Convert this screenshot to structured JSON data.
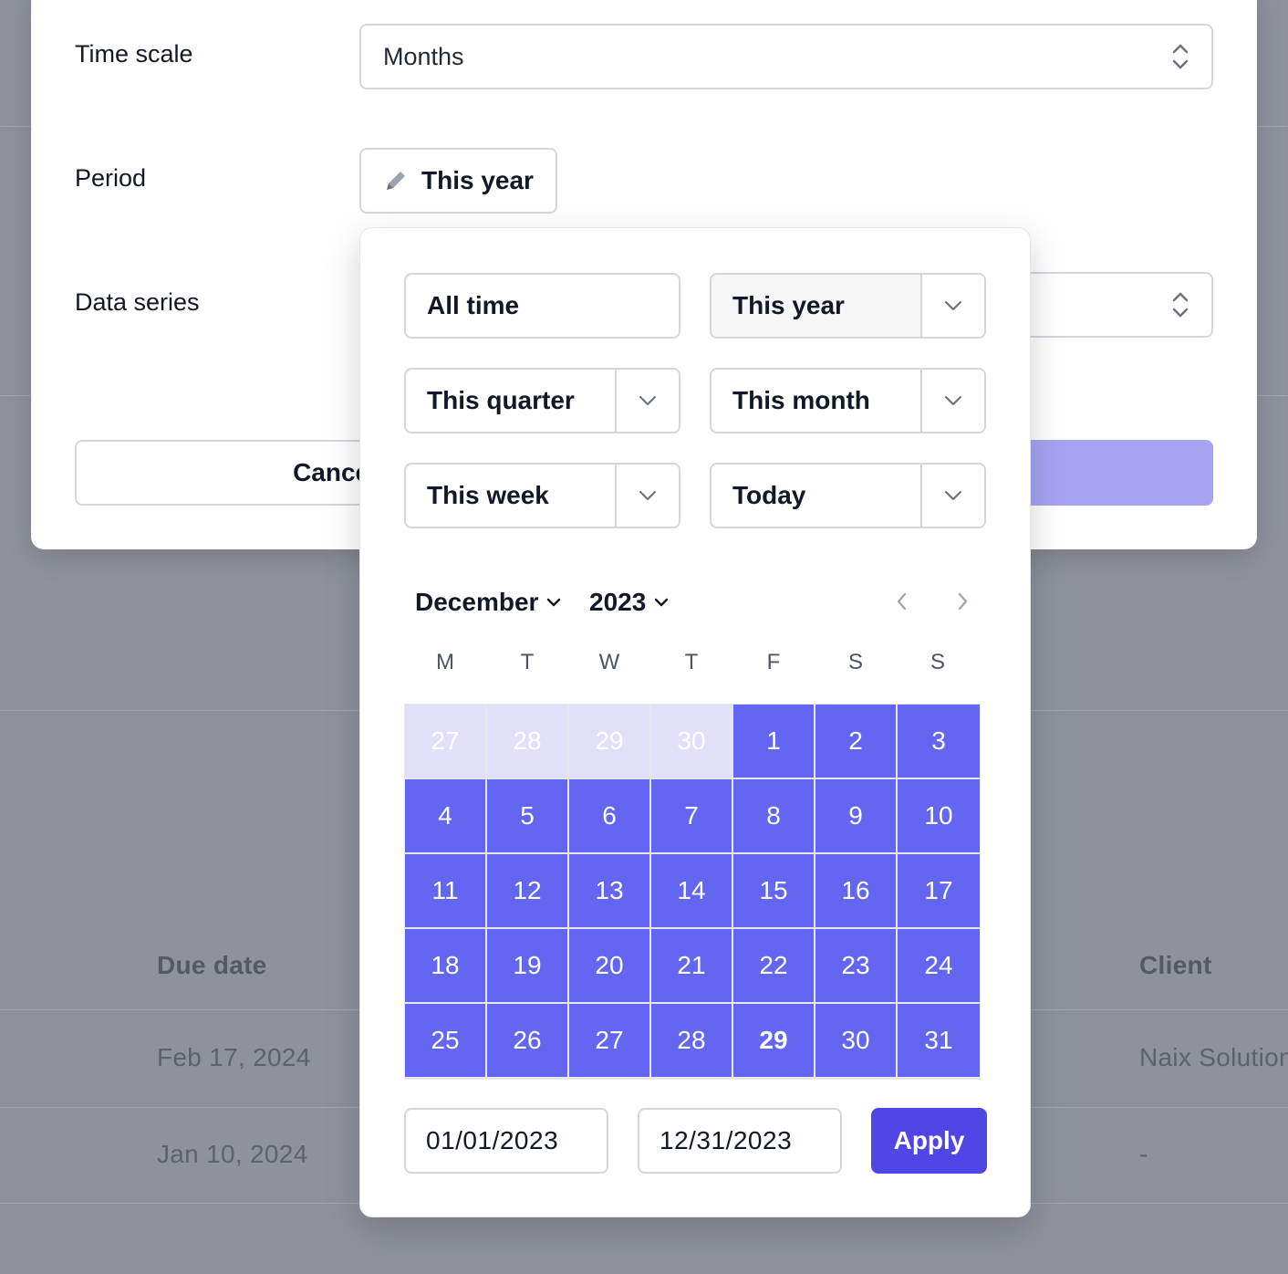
{
  "background": {
    "headers": {
      "due_date": "Due date",
      "client": "Client"
    },
    "rows": [
      {
        "due_date": "Feb 17, 2024",
        "client": "Naix Solution"
      },
      {
        "due_date": "Jan 10, 2024",
        "client": "-"
      }
    ]
  },
  "modal": {
    "time_scale_label": "Time scale",
    "time_scale_value": "Months",
    "period_label": "Period",
    "period_value": "This year",
    "data_series_label": "Data series",
    "cancel_label": "Cancel"
  },
  "popover": {
    "presets": [
      {
        "label": "All time",
        "has_menu": false,
        "active": false
      },
      {
        "label": "This year",
        "has_menu": true,
        "active": true
      },
      {
        "label": "This quarter",
        "has_menu": true,
        "active": false
      },
      {
        "label": "This month",
        "has_menu": true,
        "active": false
      },
      {
        "label": "This week",
        "has_menu": true,
        "active": false
      },
      {
        "label": "Today",
        "has_menu": true,
        "active": false
      }
    ],
    "calendar": {
      "month": "December",
      "year": "2023",
      "weekdays": [
        "M",
        "T",
        "W",
        "T",
        "F",
        "S",
        "S"
      ],
      "days": [
        {
          "n": "27",
          "out": true
        },
        {
          "n": "28",
          "out": true
        },
        {
          "n": "29",
          "out": true
        },
        {
          "n": "30",
          "out": true
        },
        {
          "n": "1"
        },
        {
          "n": "2"
        },
        {
          "n": "3"
        },
        {
          "n": "4"
        },
        {
          "n": "5"
        },
        {
          "n": "6"
        },
        {
          "n": "7"
        },
        {
          "n": "8"
        },
        {
          "n": "9"
        },
        {
          "n": "10"
        },
        {
          "n": "11"
        },
        {
          "n": "12"
        },
        {
          "n": "13"
        },
        {
          "n": "14"
        },
        {
          "n": "15"
        },
        {
          "n": "16"
        },
        {
          "n": "17"
        },
        {
          "n": "18"
        },
        {
          "n": "19"
        },
        {
          "n": "20"
        },
        {
          "n": "21"
        },
        {
          "n": "22"
        },
        {
          "n": "23"
        },
        {
          "n": "24"
        },
        {
          "n": "25"
        },
        {
          "n": "26"
        },
        {
          "n": "27"
        },
        {
          "n": "28"
        },
        {
          "n": "29",
          "today": true
        },
        {
          "n": "30"
        },
        {
          "n": "31"
        }
      ]
    },
    "start_date": "01/01/2023",
    "end_date": "12/31/2023",
    "apply_label": "Apply"
  },
  "colors": {
    "accent": "#4f46e5",
    "range": "#6366f1",
    "range_out": "#e0e0fb"
  }
}
